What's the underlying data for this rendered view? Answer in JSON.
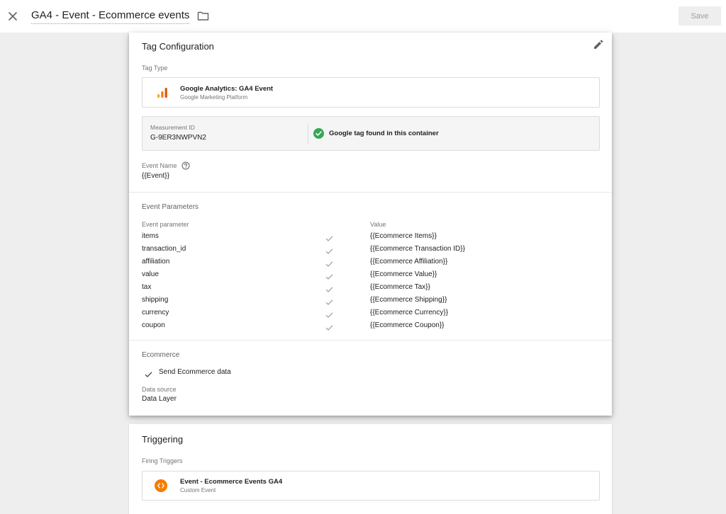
{
  "header": {
    "title": "GA4 - Event - Ecommerce events",
    "save_label": "Save"
  },
  "tag_config": {
    "title": "Tag Configuration",
    "tag_type_label": "Tag Type",
    "tag_type": {
      "name": "Google Analytics: GA4 Event",
      "provider": "Google Marketing Platform",
      "icon": "analytics-bars-icon",
      "color": "#f57c00"
    },
    "measurement": {
      "label": "Measurement ID",
      "value": "G-9ER3NWPVN2",
      "status": "Google tag found in this container",
      "status_color": "#34a853"
    },
    "event_name": {
      "label": "Event Name",
      "value": "{{Event}}"
    },
    "event_parameters": {
      "title": "Event Parameters",
      "col_param": "Event parameter",
      "col_value": "Value",
      "rows": [
        {
          "param": "items",
          "value": "{{Ecommerce Items}}"
        },
        {
          "param": "transaction_id",
          "value": "{{Ecommerce Transaction ID}}"
        },
        {
          "param": "affiliation",
          "value": "{{Ecommerce Affiliation}}"
        },
        {
          "param": "value",
          "value": "{{Ecommerce Value}}"
        },
        {
          "param": "tax",
          "value": "{{Ecommerce Tax}}"
        },
        {
          "param": "shipping",
          "value": "{{Ecommerce Shipping}}"
        },
        {
          "param": "currency",
          "value": "{{Ecommerce Currency}}"
        },
        {
          "param": "coupon",
          "value": "{{Ecommerce Coupon}}"
        }
      ]
    },
    "ecommerce": {
      "title": "Ecommerce",
      "send_label": "Send Ecommerce data",
      "data_source_label": "Data source",
      "data_source_value": "Data Layer"
    }
  },
  "triggering": {
    "title": "Triggering",
    "firing_label": "Firing Triggers",
    "trigger": {
      "name": "Event - Ecommerce Events GA4",
      "type": "Custom Event",
      "icon": "custom-event-icon",
      "color": "#f57c00"
    }
  }
}
